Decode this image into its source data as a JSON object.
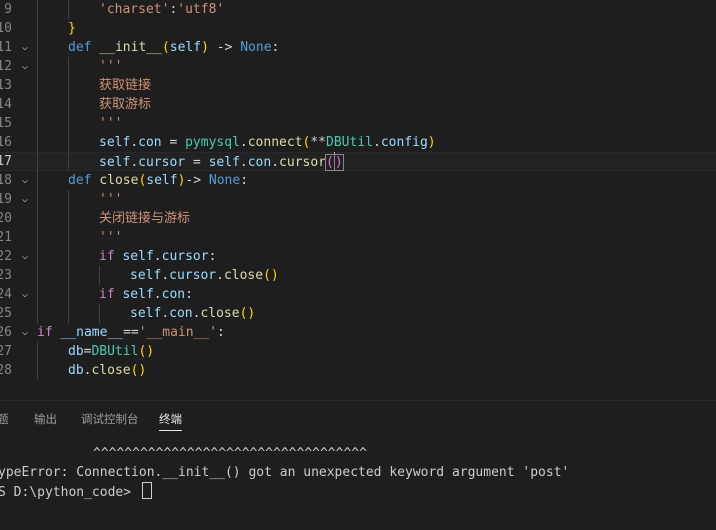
{
  "editor": {
    "lines": [
      {
        "n": "9",
        "fold": false,
        "current": false,
        "indent": 2,
        "tokens": [
          [
            "str",
            "'charset'"
          ],
          [
            "pun",
            ":"
          ],
          [
            "str",
            "'utf8'"
          ]
        ]
      },
      {
        "n": "10",
        "fold": false,
        "current": false,
        "indent": 1,
        "tokens": [
          [
            "brk",
            "}"
          ]
        ]
      },
      {
        "n": "11",
        "fold": true,
        "current": false,
        "indent": 1,
        "tokens": [
          [
            "kw",
            "def"
          ],
          [
            "pun",
            " "
          ],
          [
            "fn",
            "__init__"
          ],
          [
            "brk",
            "("
          ],
          [
            "var",
            "self"
          ],
          [
            "brk",
            ")"
          ],
          [
            "pun",
            " -> "
          ],
          [
            "kw",
            "None"
          ],
          [
            "pun",
            ":"
          ]
        ]
      },
      {
        "n": "12",
        "fold": true,
        "current": false,
        "indent": 2,
        "tokens": [
          [
            "str",
            "'''"
          ]
        ]
      },
      {
        "n": "13",
        "fold": false,
        "current": false,
        "indent": 2,
        "tokens": [
          [
            "cjk",
            "获取链接"
          ]
        ]
      },
      {
        "n": "14",
        "fold": false,
        "current": false,
        "indent": 2,
        "tokens": [
          [
            "cjk",
            "获取游标"
          ]
        ]
      },
      {
        "n": "15",
        "fold": false,
        "current": false,
        "indent": 2,
        "tokens": [
          [
            "str",
            "'''"
          ]
        ]
      },
      {
        "n": "16",
        "fold": false,
        "current": false,
        "indent": 2,
        "tokens": [
          [
            "var",
            "self"
          ],
          [
            "pun",
            "."
          ],
          [
            "var",
            "con"
          ],
          [
            "pun",
            " = "
          ],
          [
            "cls",
            "pymysql"
          ],
          [
            "pun",
            "."
          ],
          [
            "fn",
            "connect"
          ],
          [
            "brk",
            "("
          ],
          [
            "pun",
            "**"
          ],
          [
            "cls",
            "DBUtil"
          ],
          [
            "pun",
            "."
          ],
          [
            "var",
            "config"
          ],
          [
            "brk",
            ")"
          ]
        ]
      },
      {
        "n": "17",
        "fold": false,
        "current": true,
        "indent": 2,
        "tokens": [
          [
            "var",
            "self"
          ],
          [
            "pun",
            "."
          ],
          [
            "var",
            "cursor"
          ],
          [
            "pun",
            " = "
          ],
          [
            "var",
            "self"
          ],
          [
            "pun",
            "."
          ],
          [
            "var",
            "con"
          ],
          [
            "pun",
            "."
          ],
          [
            "fn",
            "cursor"
          ],
          [
            "bm",
            "("
          ],
          [
            "caret",
            ""
          ],
          [
            "bm",
            ")"
          ]
        ]
      },
      {
        "n": "18",
        "fold": true,
        "current": false,
        "indent": 1,
        "tokens": [
          [
            "kw",
            "def"
          ],
          [
            "pun",
            " "
          ],
          [
            "fn",
            "close"
          ],
          [
            "brk",
            "("
          ],
          [
            "var",
            "self"
          ],
          [
            "brk",
            ")"
          ],
          [
            "pun",
            "-> "
          ],
          [
            "kw",
            "None"
          ],
          [
            "pun",
            ":"
          ]
        ]
      },
      {
        "n": "19",
        "fold": true,
        "current": false,
        "indent": 2,
        "tokens": [
          [
            "str",
            "'''"
          ]
        ]
      },
      {
        "n": "20",
        "fold": false,
        "current": false,
        "indent": 2,
        "tokens": [
          [
            "cjk",
            "关闭链接与游标"
          ]
        ]
      },
      {
        "n": "21",
        "fold": false,
        "current": false,
        "indent": 2,
        "tokens": [
          [
            "str",
            "'''"
          ]
        ]
      },
      {
        "n": "22",
        "fold": true,
        "current": false,
        "indent": 2,
        "tokens": [
          [
            "ctl",
            "if"
          ],
          [
            "pun",
            " "
          ],
          [
            "var",
            "self"
          ],
          [
            "pun",
            "."
          ],
          [
            "var",
            "cursor"
          ],
          [
            "pun",
            ":"
          ]
        ]
      },
      {
        "n": "23",
        "fold": false,
        "current": false,
        "indent": 3,
        "tokens": [
          [
            "var",
            "self"
          ],
          [
            "pun",
            "."
          ],
          [
            "var",
            "cursor"
          ],
          [
            "pun",
            "."
          ],
          [
            "fn",
            "close"
          ],
          [
            "brk",
            "()"
          ]
        ]
      },
      {
        "n": "24",
        "fold": true,
        "current": false,
        "indent": 2,
        "tokens": [
          [
            "ctl",
            "if"
          ],
          [
            "pun",
            " "
          ],
          [
            "var",
            "self"
          ],
          [
            "pun",
            "."
          ],
          [
            "var",
            "con"
          ],
          [
            "pun",
            ":"
          ]
        ]
      },
      {
        "n": "25",
        "fold": false,
        "current": false,
        "indent": 3,
        "tokens": [
          [
            "var",
            "self"
          ],
          [
            "pun",
            "."
          ],
          [
            "var",
            "con"
          ],
          [
            "pun",
            "."
          ],
          [
            "fn",
            "close"
          ],
          [
            "brk",
            "()"
          ]
        ]
      },
      {
        "n": "26",
        "fold": true,
        "current": false,
        "indent": 0,
        "tokens": [
          [
            "ctl",
            "if"
          ],
          [
            "pun",
            " "
          ],
          [
            "var",
            "__name__"
          ],
          [
            "pun",
            "=="
          ],
          [
            "str",
            "'__main__'"
          ],
          [
            "pun",
            ":"
          ]
        ]
      },
      {
        "n": "27",
        "fold": false,
        "current": false,
        "indent": 1,
        "tokens": [
          [
            "var",
            "db"
          ],
          [
            "pun",
            "="
          ],
          [
            "cls",
            "DBUtil"
          ],
          [
            "brk",
            "()"
          ]
        ]
      },
      {
        "n": "28",
        "fold": false,
        "current": false,
        "indent": 1,
        "tokens": [
          [
            "var",
            "db"
          ],
          [
            "pun",
            "."
          ],
          [
            "fn",
            "close"
          ],
          [
            "brk",
            "()"
          ]
        ]
      }
    ]
  },
  "panel": {
    "tabs": [
      {
        "label": "题",
        "active": false
      },
      {
        "label": "输出",
        "active": false
      },
      {
        "label": "调试控制台",
        "active": false
      },
      {
        "label": "终端",
        "active": true
      }
    ]
  },
  "terminal": {
    "carets": "^^^^^^^^^^^^^^^^^^^^^^^^^^^^^^^^^^^",
    "error": "ypeError: Connection.__init__() got an unexpected keyword argument 'post'",
    "prompt": "S D:\\python_code> "
  }
}
